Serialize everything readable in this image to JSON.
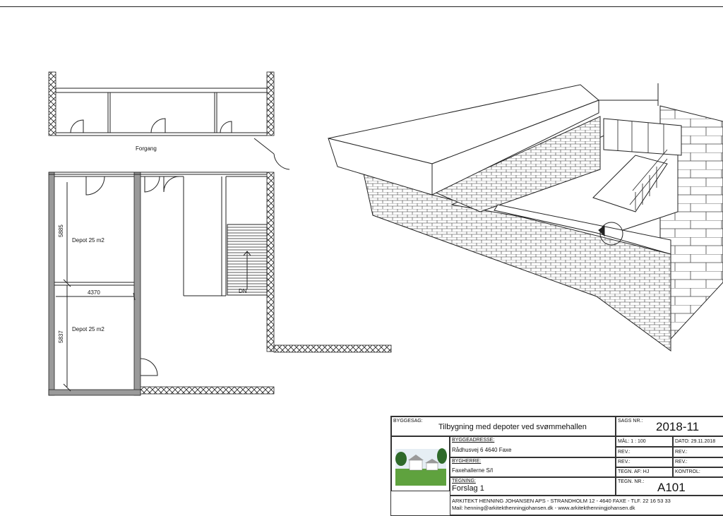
{
  "plan": {
    "room_forgang": "Forgang",
    "room_depot_1": "Depot 25 m2",
    "room_depot_2": "Depot 25 m2",
    "dim_horizontal": "4370",
    "dim_vertical_1": "5885",
    "dim_vertical_2": "5837",
    "stair_label": "DN"
  },
  "title_block": {
    "byggesag_label": "BYGGESAG:",
    "byggesag_value": "Tilbygning med depoter ved svømmehallen",
    "sags_nr_label": "SAGS NR.:",
    "sags_nr_value": "2018-11",
    "byggeadresse_label": "BYGGEADRESSE:",
    "byggeadresse_value": "Rådhusvej 6 4640 Faxe",
    "bygherre_label": "BYGHERRE:",
    "bygherre_value": "Faxehallerne S/I",
    "tegning_label": "TEGNING:",
    "tegning_value": "Forslag 1",
    "maal": "MÅL:  1 : 100",
    "dato": "DATO: 29.11.2018",
    "rev_1": "REV.:",
    "rev_2": "REV.:",
    "rev_3": "REV.:",
    "rev_4": "REV.:",
    "tegn_af": "TEGN. AF:  HJ",
    "kontrol": "KONTROL:",
    "tegn_nr_label": "TEGN. NR.:",
    "tegn_nr_value": "A101",
    "firm_line_1": "ARKITEKT HENNING JOHANSEN APS - STRANDHOLM 12 - 4640 FAXE - TLF. 22 16 53 33",
    "firm_line_2": "Mail: henning@arkitekthenningjohansen.dk - www.arkitekthenningjohansen.dk"
  }
}
